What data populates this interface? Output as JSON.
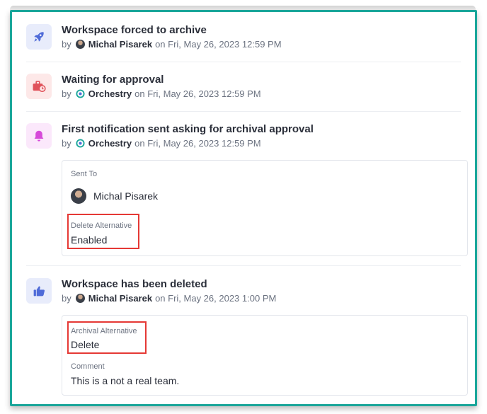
{
  "events": [
    {
      "title": "Workspace forced to archive",
      "by": "by",
      "actor": "Michal Pisarek",
      "on": "on Fri, May 26, 2023 12:59 PM",
      "icon": "rocket-icon",
      "icon_bg": "#e8ecfb",
      "icon_color": "#4f6bd8"
    },
    {
      "title": "Waiting for approval",
      "by": "by",
      "actor": "Orchestry",
      "on": "on Fri, May 26, 2023 12:59 PM",
      "icon": "briefcase-clock-icon",
      "icon_bg": "#fde8e8",
      "icon_color": "#e0525a"
    },
    {
      "title": "First notification sent asking for archival approval",
      "by": "by",
      "actor": "Orchestry",
      "on": "on Fri, May 26, 2023 12:59 PM",
      "icon": "bell-icon",
      "icon_bg": "#fbe8fb",
      "icon_color": "#d64ad9",
      "details": {
        "sent_to_label": "Sent To",
        "sent_to_value": "Michal Pisarek",
        "delete_alt_label": "Delete Alternative",
        "delete_alt_value": "Enabled"
      }
    },
    {
      "title": "Workspace has been deleted",
      "by": "by",
      "actor": "Michal Pisarek",
      "on": "on Fri, May 26, 2023 1:00 PM",
      "icon": "thumbs-up-icon",
      "icon_bg": "#e8ecfb",
      "icon_color": "#4f6bd8",
      "details": {
        "archival_alt_label": "Archival Alternative",
        "archival_alt_value": "Delete",
        "comment_label": "Comment",
        "comment_value": "This is a not a real team."
      }
    }
  ],
  "colors": {
    "frame_border": "#1aa69a",
    "highlight_box": "#e53935"
  }
}
